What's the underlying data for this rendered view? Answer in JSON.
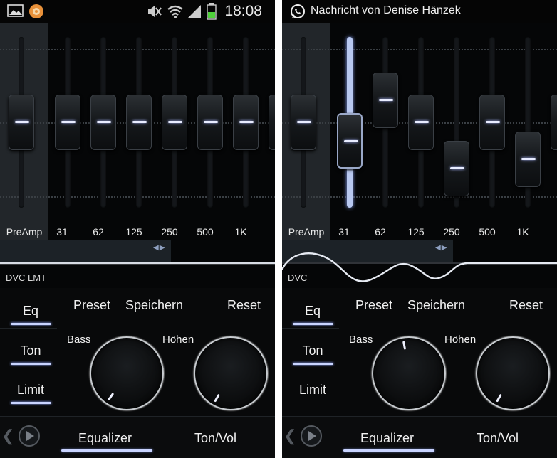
{
  "screens": [
    {
      "status": {
        "time": "18:08",
        "notification": ""
      },
      "bands": [
        {
          "label": "PreAmp",
          "level": 0.5
        },
        {
          "label": "31",
          "level": 0.5
        },
        {
          "label": "62",
          "level": 0.5
        },
        {
          "label": "125",
          "level": 0.5
        },
        {
          "label": "250",
          "level": 0.5
        },
        {
          "label": "500",
          "level": 0.5
        },
        {
          "label": "1K",
          "level": 0.5
        }
      ],
      "selected_band": null,
      "curve_label": "DVC LMT",
      "buttons": {
        "eq": "Eq",
        "ton": "Ton",
        "limit": "Limit",
        "preset": "Preset",
        "speichern": "Speichern",
        "reset": "Reset"
      },
      "dials": {
        "bass_label": "Bass",
        "hoehen_label": "Höhen",
        "bass_angle": 215,
        "hoehen_angle": 210
      },
      "tabs": {
        "equalizer": "Equalizer",
        "ton_vol": "Ton/Vol"
      }
    },
    {
      "status": {
        "time": "",
        "notification": "Nachricht von Denise Hänzek"
      },
      "bands": [
        {
          "label": "PreAmp",
          "level": 0.5
        },
        {
          "label": "31",
          "level": 0.34
        },
        {
          "label": "62",
          "level": 0.69
        },
        {
          "label": "125",
          "level": 0.5
        },
        {
          "label": "250",
          "level": 0.1
        },
        {
          "label": "500",
          "level": 0.5
        },
        {
          "label": "1K",
          "level": 0.18
        }
      ],
      "selected_band": 1,
      "curve_label": "DVC",
      "buttons": {
        "eq": "Eq",
        "ton": "Ton",
        "limit": "Limit",
        "preset": "Preset",
        "speichern": "Speichern",
        "reset": "Reset"
      },
      "dials": {
        "bass_label": "Bass",
        "hoehen_label": "Höhen",
        "bass_angle": 350,
        "hoehen_angle": 210
      },
      "tabs": {
        "equalizer": "Equalizer",
        "ton_vol": "Ton/Vol"
      }
    }
  ],
  "colors": {
    "accent": "#c9d4ff",
    "background": "#000000"
  }
}
